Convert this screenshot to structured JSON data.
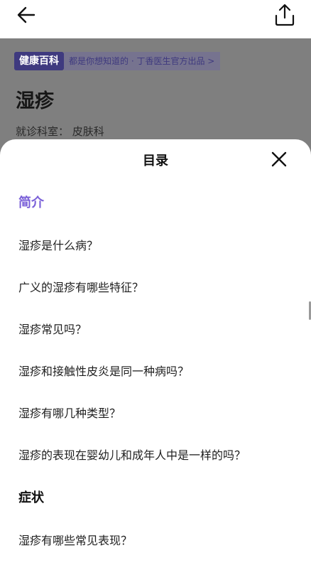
{
  "header": {
    "back_icon": "arrow-left-icon",
    "share_icon": "share-upload-icon"
  },
  "background_page": {
    "promo_badge": "健康百科",
    "promo_text": "都是你想知道的 · 丁香医生官方出品 >",
    "title": "湿疹",
    "department": "就诊科室：  皮肤科"
  },
  "toc_sheet": {
    "title": "目录",
    "close_icon": "close-icon",
    "sections": [
      {
        "label": "简介",
        "active": true,
        "items": [
          "湿疹是什么病？",
          "广义的湿疹有哪些特征？",
          "湿疹常见吗？",
          "湿疹和接触性皮炎是同一种病吗？",
          "湿疹有哪几种类型？",
          "湿疹的表现在婴幼儿和成年人中是一样的吗？"
        ]
      },
      {
        "label": "症状",
        "active": false,
        "items": [
          "湿疹有哪些常见表现？"
        ]
      }
    ]
  },
  "colors": {
    "accent": "#7a60d8",
    "overlay": "#7f7f7f",
    "badge_bg": "#3f3a7f"
  }
}
